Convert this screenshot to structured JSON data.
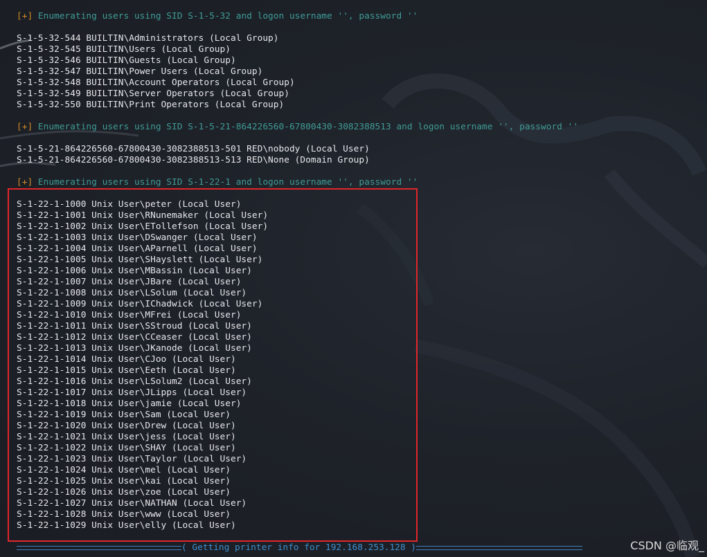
{
  "status1": {
    "bracket": "[+]",
    "text": " Enumerating users using SID S-1-5-32 and logon username '', password ''"
  },
  "group1": [
    "S-1-5-32-544 BUILTIN\\Administrators (Local Group)",
    "S-1-5-32-545 BUILTIN\\Users (Local Group)",
    "S-1-5-32-546 BUILTIN\\Guests (Local Group)",
    "S-1-5-32-547 BUILTIN\\Power Users (Local Group)",
    "S-1-5-32-548 BUILTIN\\Account Operators (Local Group)",
    "S-1-5-32-549 BUILTIN\\Server Operators (Local Group)",
    "S-1-5-32-550 BUILTIN\\Print Operators (Local Group)"
  ],
  "status2": {
    "bracket": "[+]",
    "text": " Enumerating users using SID S-1-5-21-864226560-67800430-3082388513 and logon username '', password ''"
  },
  "group2": [
    "S-1-5-21-864226560-67800430-3082388513-501 RED\\nobody (Local User)",
    "S-1-5-21-864226560-67800430-3082388513-513 RED\\None (Domain Group)"
  ],
  "status3": {
    "bracket": "[+]",
    "text": " Enumerating users using SID S-1-22-1 and logon username '', password ''"
  },
  "group3": [
    "S-1-22-1-1000 Unix User\\peter (Local User)",
    "S-1-22-1-1001 Unix User\\RNunemaker (Local User)",
    "S-1-22-1-1002 Unix User\\ETollefson (Local User)",
    "S-1-22-1-1003 Unix User\\DSwanger (Local User)",
    "S-1-22-1-1004 Unix User\\AParnell (Local User)",
    "S-1-22-1-1005 Unix User\\SHayslett (Local User)",
    "S-1-22-1-1006 Unix User\\MBassin (Local User)",
    "S-1-22-1-1007 Unix User\\JBare (Local User)",
    "S-1-22-1-1008 Unix User\\LSolum (Local User)",
    "S-1-22-1-1009 Unix User\\IChadwick (Local User)",
    "S-1-22-1-1010 Unix User\\MFrei (Local User)",
    "S-1-22-1-1011 Unix User\\SStroud (Local User)",
    "S-1-22-1-1012 Unix User\\CCeaser (Local User)",
    "S-1-22-1-1013 Unix User\\JKanode (Local User)",
    "S-1-22-1-1014 Unix User\\CJoo (Local User)",
    "S-1-22-1-1015 Unix User\\Eeth (Local User)",
    "S-1-22-1-1016 Unix User\\LSolum2 (Local User)",
    "S-1-22-1-1017 Unix User\\JLipps (Local User)",
    "S-1-22-1-1018 Unix User\\jamie (Local User)",
    "S-1-22-1-1019 Unix User\\Sam (Local User)",
    "S-1-22-1-1020 Unix User\\Drew (Local User)",
    "S-1-22-1-1021 Unix User\\jess (Local User)",
    "S-1-22-1-1022 Unix User\\SHAY (Local User)",
    "S-1-22-1-1023 Unix User\\Taylor (Local User)",
    "S-1-22-1-1024 Unix User\\mel (Local User)",
    "S-1-22-1-1025 Unix User\\kai (Local User)",
    "S-1-22-1-1026 Unix User\\zoe (Local User)",
    "S-1-22-1-1027 Unix User\\NATHAN (Local User)",
    "S-1-22-1-1028 Unix User\\www (Local User)",
    "S-1-22-1-1029 Unix User\\elly (Local User)"
  ],
  "footer": {
    "text": "( Getting printer info for 192.168.253.128 )"
  },
  "watermark": "CSDN @临观_",
  "colors": {
    "background": "#1d2026",
    "text": "#e6e8eb",
    "status": "#3f9c96",
    "bracket": "#d28b26",
    "highlight": "#e1262a",
    "footer": "#3f8fd0"
  }
}
